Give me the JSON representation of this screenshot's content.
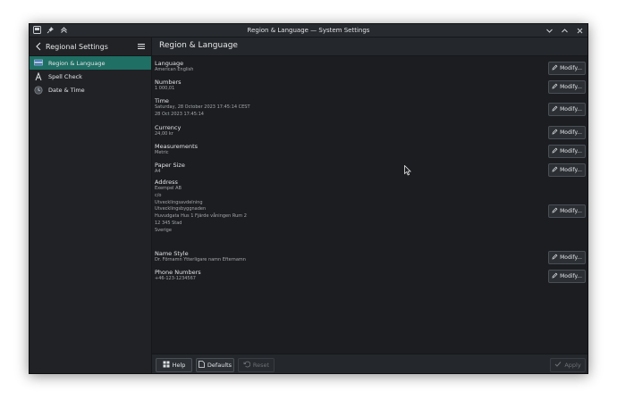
{
  "window": {
    "title": "Region & Language — System Settings"
  },
  "sidebar": {
    "title": "Regional Settings",
    "items": [
      {
        "label": "Region & Language",
        "icon": "flag-icon",
        "active": true
      },
      {
        "label": "Spell Check",
        "icon": "spell-check-icon",
        "active": false
      },
      {
        "label": "Date & Time",
        "icon": "clock-icon",
        "active": false
      }
    ]
  },
  "main": {
    "title": "Region & Language",
    "modify_label": "Modify...",
    "settings": {
      "language": {
        "label": "Language",
        "value": "American English"
      },
      "numbers": {
        "label": "Numbers",
        "value": "1 000,01"
      },
      "time": {
        "label": "Time",
        "value1": "Saturday, 28 October 2023 17:45:14 CEST",
        "value2": "28 Oct 2023 17:45:14"
      },
      "currency": {
        "label": "Currency",
        "value": "24,00 kr"
      },
      "measurements": {
        "label": "Measurements",
        "value": "Metric"
      },
      "paper_size": {
        "label": "Paper Size",
        "value": "A4"
      },
      "address": {
        "label": "Address",
        "lines": [
          "Exempel AB",
          "c/o",
          "Utvecklingsavdelning",
          "Utvecklingsbyggnaden",
          "Huvudgata Hus 1 Fjärde våningen Rum 2",
          "12 345 Stad",
          "Sverige"
        ]
      },
      "name_style": {
        "label": "Name Style",
        "value": "Dr. Förnamn Ytterligare namn Efternamn"
      },
      "phone_numbers": {
        "label": "Phone Numbers",
        "value": "+46-123-1234567"
      }
    }
  },
  "footer": {
    "help": "Help",
    "defaults": "Defaults",
    "reset": "Reset",
    "apply": "Apply"
  },
  "colors": {
    "accent": "#1f6f64",
    "window_bg": "#1b1d20",
    "sidebar_bg": "#202225"
  }
}
